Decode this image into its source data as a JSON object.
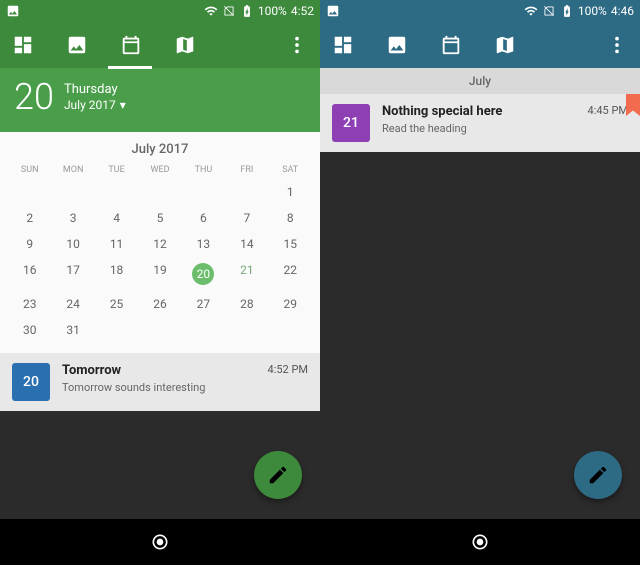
{
  "left": {
    "status": {
      "time": "4:52",
      "battery": "100%"
    },
    "header": {
      "bigDay": "20",
      "weekday": "Thursday",
      "monthYear": "July 2017"
    },
    "calendar": {
      "title": "July 2017",
      "dow": [
        "SUN",
        "MON",
        "TUE",
        "WED",
        "THU",
        "FRI",
        "SAT"
      ],
      "startPad": 6,
      "days": 31,
      "today": 20,
      "eventDay": 21
    },
    "event": {
      "chip": "20",
      "title": "Tomorrow",
      "sub": "Tomorrow sounds interesting",
      "time": "4:52 PM"
    }
  },
  "right": {
    "status": {
      "time": "4:46",
      "battery": "100%"
    },
    "sectionHeader": "July",
    "event": {
      "chip": "21",
      "title": "Nothing special here",
      "sub": "Read the heading",
      "time": "4:45 PM"
    }
  }
}
